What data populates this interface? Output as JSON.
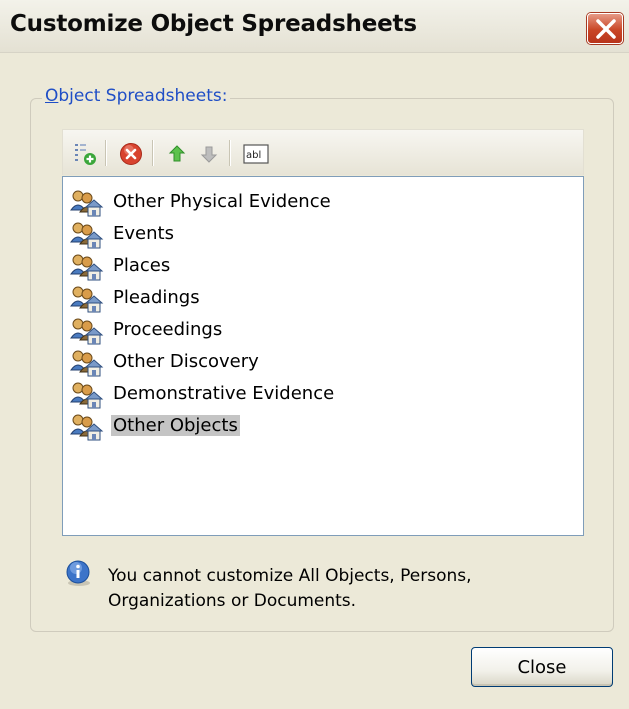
{
  "window": {
    "title": "Customize Object Spreadsheets",
    "close_icon": "close-x-icon",
    "close_color": "#c94626"
  },
  "group": {
    "legend_underlined": "O",
    "legend_rest": "bject Spreadsheets:",
    "legend_color": "#1f4ec6"
  },
  "toolbar": {
    "items": [
      {
        "name": "add-spreadsheet",
        "icon": "add-list-icon"
      },
      {
        "name": "delete",
        "icon": "delete-red-icon"
      },
      {
        "name": "move-up",
        "icon": "arrow-up-green-icon"
      },
      {
        "name": "move-down",
        "icon": "arrow-down-gray-icon"
      },
      {
        "name": "rename",
        "icon": "text-field-icon",
        "glyph": "abl"
      }
    ]
  },
  "list": {
    "items": [
      {
        "label": "Other Physical Evidence",
        "selected": false
      },
      {
        "label": "Events",
        "selected": false
      },
      {
        "label": "Places",
        "selected": false
      },
      {
        "label": "Pleadings",
        "selected": false
      },
      {
        "label": "Proceedings",
        "selected": false
      },
      {
        "label": "Other Discovery",
        "selected": false
      },
      {
        "label": "Demonstrative Evidence",
        "selected": false
      },
      {
        "label": "Other Objects",
        "selected": true
      }
    ],
    "item_icon": "people-house-icon"
  },
  "info": {
    "icon": "info-icon",
    "line1": "You cannot customize All Objects, Persons,",
    "line2": "Organizations or Documents."
  },
  "buttons": {
    "close_label": "Close"
  }
}
